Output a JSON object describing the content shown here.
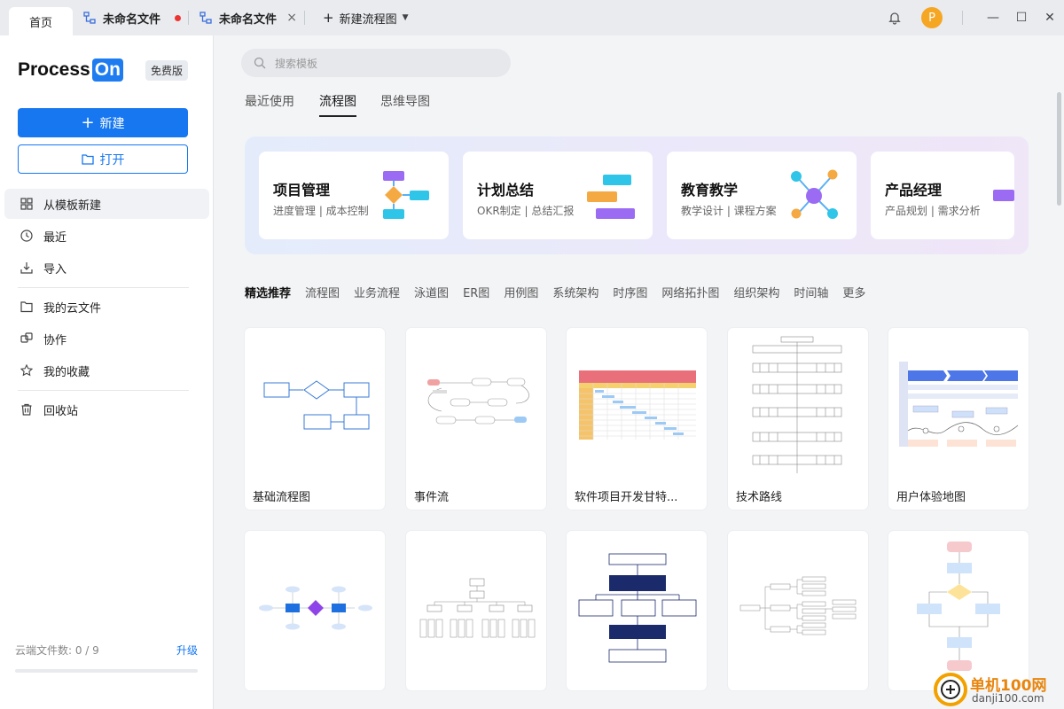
{
  "tabs": {
    "home": "首页",
    "file1": "未命名文件",
    "file2": "未命名文件",
    "new_flow": "新建流程图"
  },
  "user": {
    "avatar_letter": "P"
  },
  "window_controls": {
    "minimize": "—",
    "maximize": "☐",
    "close": "✕"
  },
  "sidebar": {
    "logo_text": "Process",
    "logo_on": "On",
    "plan_badge": "免费版",
    "new_button": "新建",
    "open_button": "打开",
    "nav": [
      {
        "label": "从模板新建",
        "icon": "template-icon"
      },
      {
        "label": "最近",
        "icon": "clock-icon"
      },
      {
        "label": "导入",
        "icon": "import-icon"
      },
      {
        "label": "我的云文件",
        "icon": "folder-icon"
      },
      {
        "label": "协作",
        "icon": "collaborate-icon"
      },
      {
        "label": "我的收藏",
        "icon": "star-icon"
      },
      {
        "label": "回收站",
        "icon": "trash-icon"
      }
    ],
    "quota_label": "云端文件数: 0 / 9",
    "upgrade": "升级"
  },
  "search": {
    "placeholder": "搜索模板"
  },
  "category_tabs": [
    "最近使用",
    "流程图",
    "思维导图"
  ],
  "active_category": "流程图",
  "banner_cards": [
    {
      "title": "项目管理",
      "subtitle": "进度管理 | 成本控制"
    },
    {
      "title": "计划总结",
      "subtitle": "OKR制定 | 总结汇报"
    },
    {
      "title": "教育教学",
      "subtitle": "教学设计 | 课程方案"
    },
    {
      "title": "产品经理",
      "subtitle": "产品规划 | 需求分析"
    }
  ],
  "filters": [
    "精选推荐",
    "流程图",
    "业务流程",
    "泳道图",
    "ER图",
    "用例图",
    "系统架构",
    "时序图",
    "网络拓扑图",
    "组织架构",
    "时间轴",
    "更多"
  ],
  "active_filter": "精选推荐",
  "templates": [
    {
      "name": "基础流程图"
    },
    {
      "name": "事件流"
    },
    {
      "name": "软件项目开发甘特..."
    },
    {
      "name": "技术路线"
    },
    {
      "name": "用户体验地图"
    },
    {
      "name": ""
    },
    {
      "name": ""
    },
    {
      "name": ""
    },
    {
      "name": ""
    },
    {
      "name": ""
    }
  ],
  "watermark": {
    "text": "单机100网",
    "url_text": "danji100.com"
  },
  "colors": {
    "accent": "#1677f0",
    "avatar": "#f5a623",
    "logo_on": "#1e7cf0"
  }
}
